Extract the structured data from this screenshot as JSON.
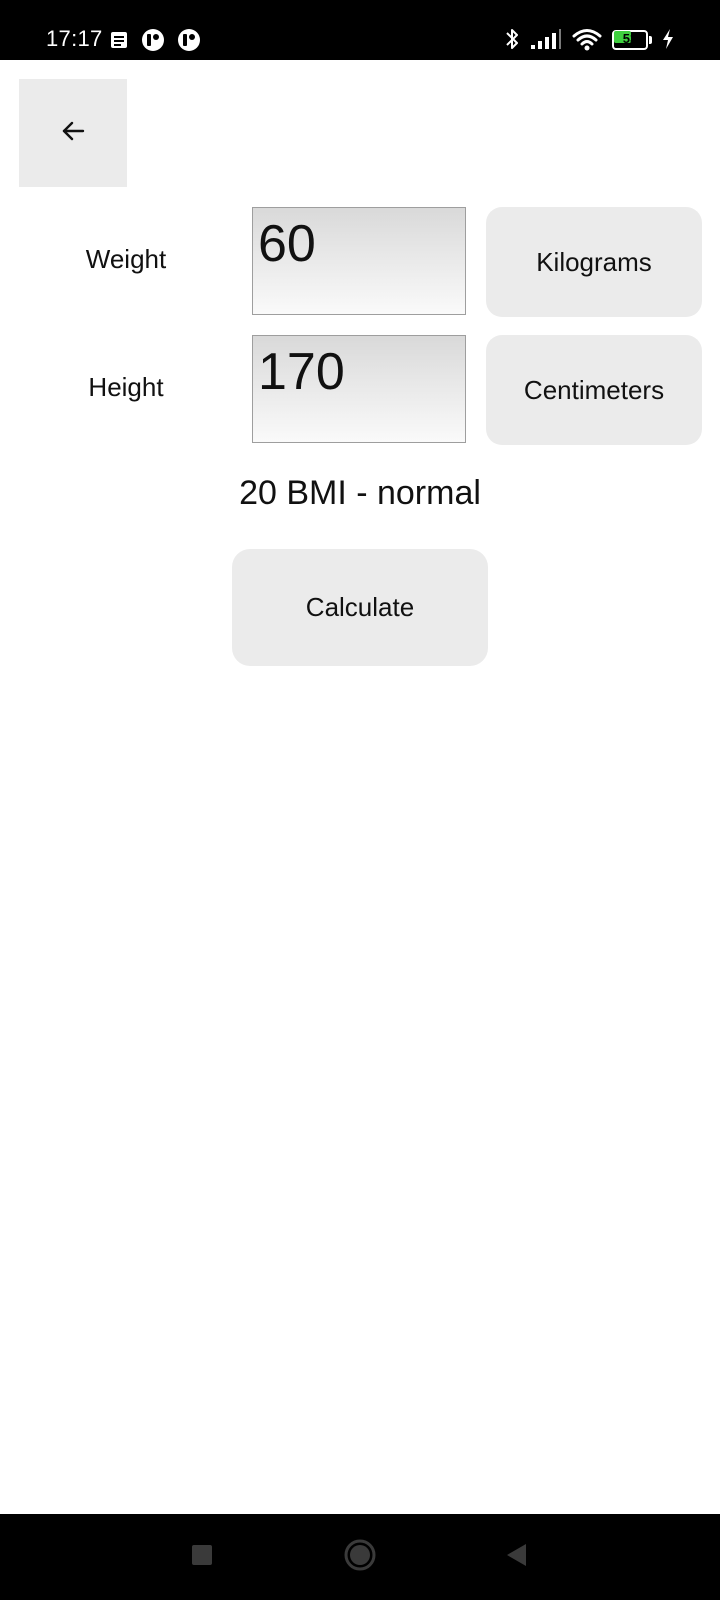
{
  "status_bar": {
    "time": "17:17",
    "battery_level": 53,
    "battery_text": "53",
    "battery_color": "#3fcf3f",
    "left_icons": [
      "notification-icon",
      "app-notification-icon",
      "app-notification-icon"
    ],
    "right_icons": [
      "bluetooth-icon",
      "cellular-signal-icon",
      "wifi-icon",
      "battery-icon",
      "charging-icon"
    ]
  },
  "app": {
    "back_icon": "arrow-left-icon",
    "weight": {
      "label": "Weight",
      "value": "60",
      "unit": "Kilograms"
    },
    "height": {
      "label": "Height",
      "value": "170",
      "unit": "Centimeters"
    },
    "result": "20 BMI - normal",
    "calculate_label": "Calculate",
    "button_color": "#ebebeb"
  },
  "nav_bar": {
    "icons": [
      "recents-square-icon",
      "home-circle-icon",
      "back-triangle-icon"
    ]
  }
}
